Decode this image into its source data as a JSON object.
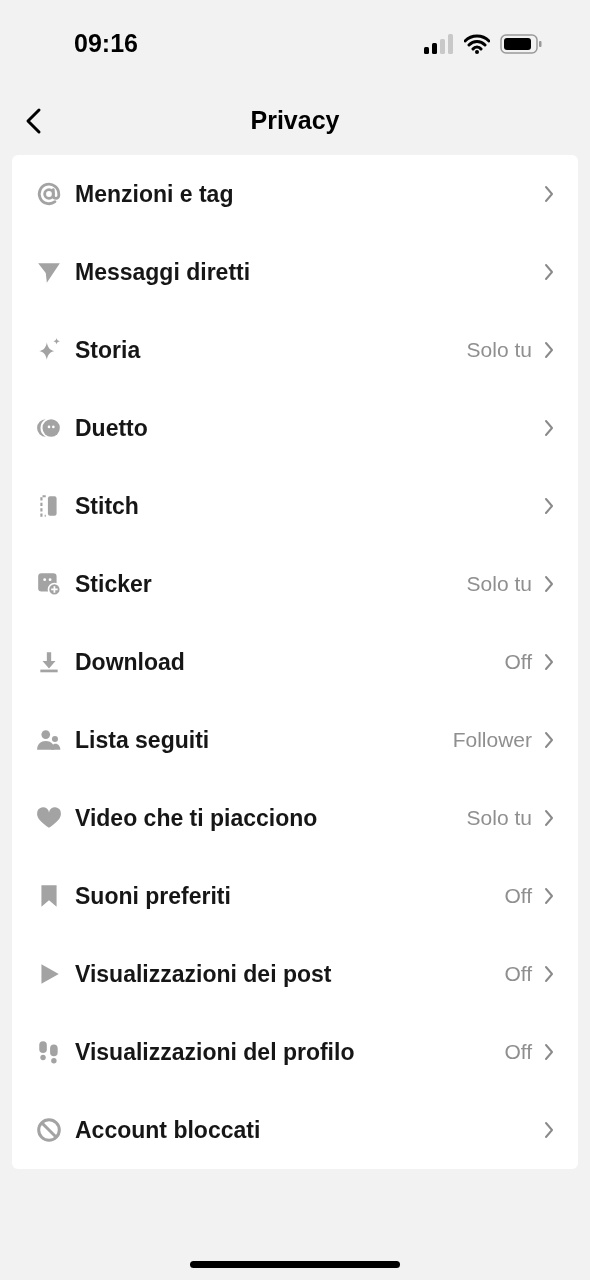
{
  "status_bar": {
    "time": "09:16"
  },
  "header": {
    "title": "Privacy"
  },
  "items": [
    {
      "label": "Menzioni e tag"
    },
    {
      "label": "Messaggi diretti"
    },
    {
      "label": "Storia",
      "value": "Solo tu"
    },
    {
      "label": "Duetto"
    },
    {
      "label": "Stitch"
    },
    {
      "label": "Sticker",
      "value": "Solo tu"
    },
    {
      "label": "Download",
      "value": "Off"
    },
    {
      "label": "Lista seguiti",
      "value": "Follower"
    },
    {
      "label": "Video che ti piacciono",
      "value": "Solo tu"
    },
    {
      "label": "Suoni preferiti",
      "value": "Off"
    },
    {
      "label": "Visualizzazioni dei post",
      "value": "Off"
    },
    {
      "label": "Visualizzazioni del profilo",
      "value": "Off"
    },
    {
      "label": "Account bloccati"
    }
  ]
}
